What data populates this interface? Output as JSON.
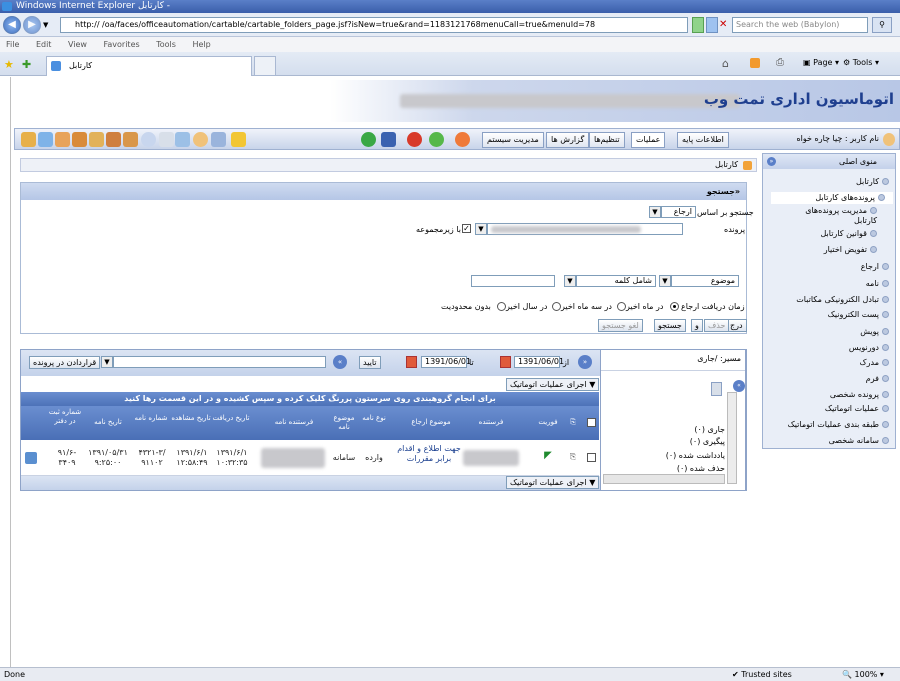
{
  "window": {
    "title": "Windows Internet Explorer",
    "title_prefix": "کارتابل -"
  },
  "browser": {
    "url": "http://            /oa/faces/officeautomation/cartable/cartable_folders_page.jsf?isNew=true&rand=1183121768menuCall=true&menuId=78",
    "search_placeholder": "Search the web (Babylon)",
    "menu": [
      "File",
      "Edit",
      "View",
      "Favorites",
      "Tools",
      "Help"
    ],
    "tab_title": "کارتابل",
    "cmd_page": "Page",
    "cmd_tools": "Tools"
  },
  "banner": {
    "title": "اتوماسیون اداری تمت وب"
  },
  "toolbar": {
    "user_label": "نام کاربر : چیا چاره خواه",
    "menus": [
      "اطلاعات پایه",
      "عملیات",
      "تنظیم‌ها",
      "گزارش ها",
      "مدیریت سیستم"
    ]
  },
  "sidebar": {
    "title": "منوی اصلی",
    "items": [
      "کارتابل",
      "پرونده‌های کارتابل",
      "مدیریت پرونده‌های کارتابل",
      "قوانین کارتابل",
      "تفویض اختیار",
      "ارجاع",
      "نامه",
      "تبادل الکترونیکی مکاتبات",
      "پست الکترونیک",
      "پویش",
      "دورنویس",
      "مدرک",
      "فرم",
      "پرونده شخصی",
      "عملیات اتوماتیک",
      "طبقه بندی عملیات اتوماتیک",
      "سامانه شخصی"
    ]
  },
  "breadcrumb": "کارتابل",
  "search": {
    "title": "«جستجو",
    "search_by_label": "جستجو بر اساس",
    "search_by_value": "ارجاع",
    "folder_label": "پرونده",
    "subfolder_label": "با زیرمجموعه",
    "field_value": "موضوع",
    "op_value": "شامل کلمه",
    "date_label": "زمان دریافت ارجاع",
    "date_options": [
      "در ماه اخیر",
      "در سه ماه اخیر",
      "در سال اخیر",
      "بدون محدودیت"
    ],
    "btn_insert": "درج",
    "btn_delete": "حذف",
    "btn_and": "و",
    "btn_search": "جستجو",
    "btn_cancel": "لغو جستجو"
  },
  "grid": {
    "from_label": "از",
    "to_label": "تا",
    "from_date": "1391/06/01",
    "to_date": "1391/06/01",
    "confirm": "تایید",
    "folder_btn": "قراردادن در پرونده",
    "auto_ops": "اجرای عملیات اتوماتیک",
    "group_hint": "برای انجام گروهبندی روی سرستون پررنگ کلیک کرده و سپس کشیده و در این قسمت رها کنید",
    "headers": [
      "فوریت",
      "فرستنده",
      "موضوع ارجاع",
      "نوع نامه",
      "موضوع نامه",
      "فرستنده نامه",
      "تاریخ دریافت",
      "تاریخ مشاهده",
      "شماره نامه",
      "تاریخ نامه",
      "شماره ثبت در دفتر"
    ],
    "row": {
      "subject": "جهت اطلاع و اقدام برابر مقررات",
      "letter_type": "وارده",
      "letter_subject": "سامانه",
      "received": "۱۳۹۱/۶/۱ ۱۰:۳۲:۳۵",
      "viewed": "۱۳۹۱/۶/۱ ۱۲:۵۸:۴۹",
      "letter_no": "۴۳۲۱-۳/ ۹۱۱۰۲",
      "letter_date": "۱۳۹۱/۰۵/۳۱ ۹:۲۵:۰۰",
      "reg_no": "۹۱/۶- ۳۴۰۹"
    }
  },
  "folders": {
    "path_label": "مسیر: /جاری",
    "items": [
      "جاری (۰)",
      "پیگیری (۰)",
      "یادداشت شده (۰)",
      "حذف شده (۰)"
    ]
  },
  "status": {
    "left": "Done",
    "zone": "Trusted sites",
    "zoom": "100%"
  }
}
